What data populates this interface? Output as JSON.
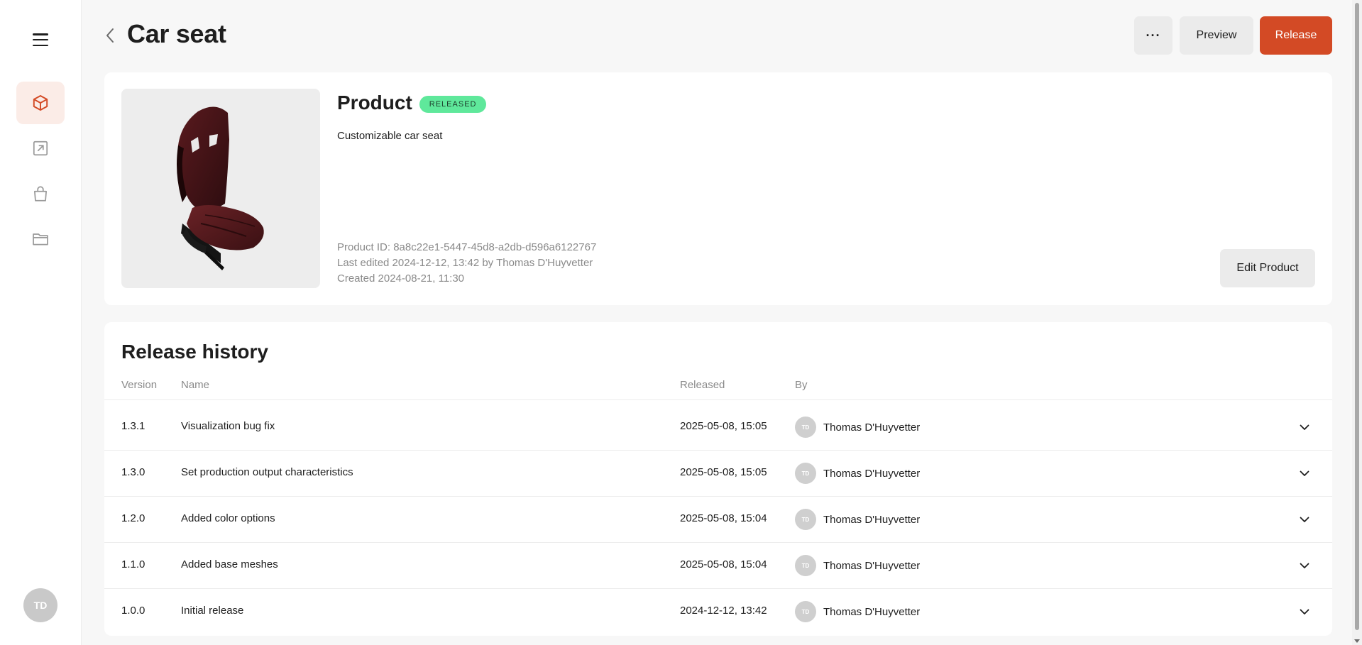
{
  "header": {
    "title": "Car seat",
    "more_label": "···",
    "preview_label": "Preview",
    "release_label": "Release"
  },
  "sidebar": {
    "items": [
      {
        "name": "products",
        "icon": "cube-icon",
        "active": true
      },
      {
        "name": "exports",
        "icon": "export-icon",
        "active": false
      },
      {
        "name": "shop",
        "icon": "shopping-bag-icon",
        "active": false
      },
      {
        "name": "files",
        "icon": "folder-icon",
        "active": false
      }
    ],
    "user_initials": "TD"
  },
  "product": {
    "heading": "Product",
    "status": "RELEASED",
    "description": "Customizable car seat",
    "product_id": "Product ID: 8a8c22e1-5447-45d8-a2db-d596a6122767",
    "last_edited": "Last edited 2024-12-12, 13:42 by Thomas D'Huyvetter",
    "created": "Created 2024-08-21, 11:30",
    "edit_label": "Edit Product"
  },
  "history": {
    "title": "Release history",
    "columns": {
      "version": "Version",
      "name": "Name",
      "released": "Released",
      "by": "By"
    },
    "rows": [
      {
        "version": "1.3.1",
        "name": "Visualization bug fix",
        "released": "2025-05-08, 15:05",
        "by": "Thomas D'Huyvetter",
        "initials": "TD"
      },
      {
        "version": "1.3.0",
        "name": "Set production output characteristics",
        "released": "2025-05-08, 15:05",
        "by": "Thomas D'Huyvetter",
        "initials": "TD"
      },
      {
        "version": "1.2.0",
        "name": "Added color options",
        "released": "2025-05-08, 15:04",
        "by": "Thomas D'Huyvetter",
        "initials": "TD"
      },
      {
        "version": "1.1.0",
        "name": "Added base meshes",
        "released": "2025-05-08, 15:04",
        "by": "Thomas D'Huyvetter",
        "initials": "TD"
      },
      {
        "version": "1.0.0",
        "name": "Initial release",
        "released": "2024-12-12, 13:42",
        "by": "Thomas D'Huyvetter",
        "initials": "TD"
      }
    ]
  },
  "colors": {
    "accent": "#d34a25",
    "badge": "#5fe89b",
    "active_nav_bg": "#fbece7"
  }
}
